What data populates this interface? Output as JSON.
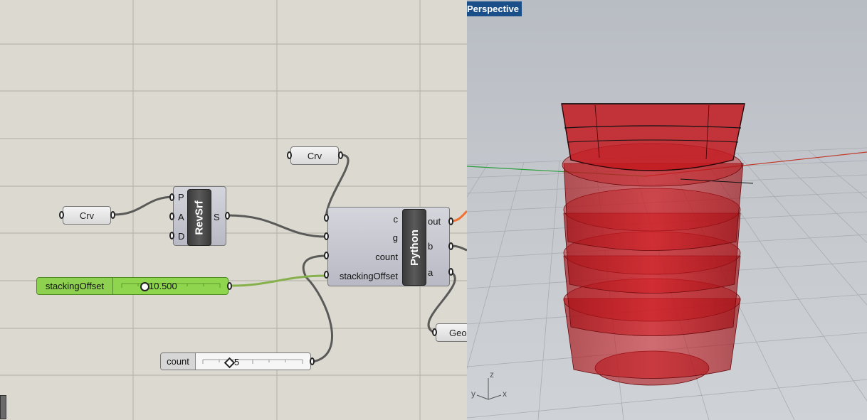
{
  "canvas": {
    "components": {
      "crv_left": {
        "label": "Crv"
      },
      "crv_top": {
        "label": "Crv"
      },
      "revsrf": {
        "name": "RevSrf",
        "inputs": [
          "P",
          "A",
          "D"
        ],
        "outputs": [
          "S"
        ]
      },
      "python": {
        "name": "Python",
        "inputs": [
          "c",
          "g",
          "count",
          "stackingOffset"
        ],
        "outputs": [
          "out",
          "b",
          "a"
        ]
      },
      "geo": {
        "label": "Geo"
      }
    },
    "sliders": {
      "stacking_offset": {
        "name": "stackingOffset",
        "value": "10.500"
      },
      "count": {
        "name": "count",
        "value": "5"
      }
    }
  },
  "viewport": {
    "title": "Perspective",
    "axes": {
      "x": "x",
      "y": "y",
      "z": "z"
    },
    "colors": {
      "geometry": "#c4161c",
      "title_bg": "#1b4f8a",
      "background": "#c7cbd1",
      "x_axis": "#c0392b",
      "y_axis": "#2e9e3e"
    }
  }
}
